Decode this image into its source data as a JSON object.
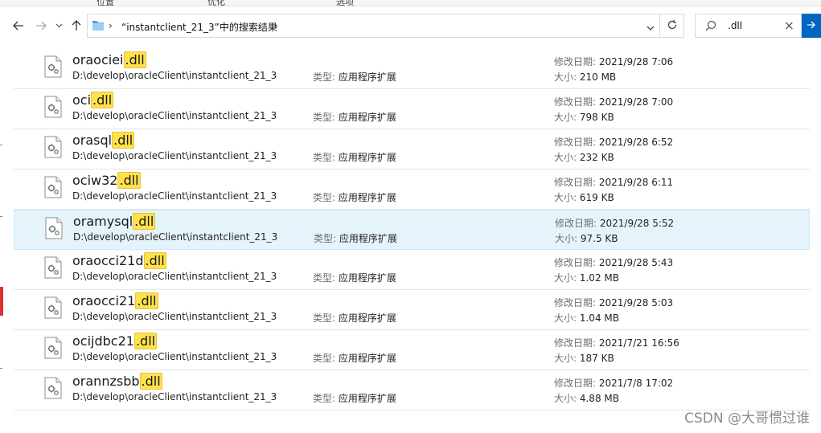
{
  "ribbon": {
    "tabs": [
      "位置",
      "优化",
      "选项"
    ]
  },
  "nav": {
    "back_icon": "arrow-left-icon",
    "forward_icon": "arrow-right-icon",
    "recent_icon": "chevron-down-icon",
    "up_icon": "arrow-up-icon"
  },
  "address": {
    "chevron_before": "›",
    "path": "“instantclient_21_3”中的搜索结果",
    "chevron_after": "›"
  },
  "search": {
    "value": ".dll",
    "clear": "×"
  },
  "labels": {
    "type": "类型: ",
    "modified": "修改日期: ",
    "size": "大小: "
  },
  "results": [
    {
      "name": ".dll",
      "stem": "oraociei",
      "path": "D:\\develop\\oracleClient\\instantclient_21_3",
      "type": "应用程序扩展",
      "modified": "2021/9/28 7:06",
      "size": "210 MB"
    },
    {
      "name": ".dll",
      "stem": "oci",
      "path": "D:\\develop\\oracleClient\\instantclient_21_3",
      "type": "应用程序扩展",
      "modified": "2021/9/28 7:00",
      "size": "798 KB"
    },
    {
      "name": ".dll",
      "stem": "orasql",
      "path": "D:\\develop\\oracleClient\\instantclient_21_3",
      "type": "应用程序扩展",
      "modified": "2021/9/28 6:52",
      "size": "232 KB"
    },
    {
      "name": ".dll",
      "stem": "ociw32",
      "path": "D:\\develop\\oracleClient\\instantclient_21_3",
      "type": "应用程序扩展",
      "modified": "2021/9/28 6:11",
      "size": "619 KB"
    },
    {
      "name": ".dll",
      "stem": "oramysql",
      "path": "D:\\develop\\oracleClient\\instantclient_21_3",
      "type": "应用程序扩展",
      "modified": "2021/9/28 5:52",
      "size": "97.5 KB"
    },
    {
      "name": ".dll",
      "stem": "oraocci21d",
      "path": "D:\\develop\\oracleClient\\instantclient_21_3",
      "type": "应用程序扩展",
      "modified": "2021/9/28 5:43",
      "size": "1.02 MB"
    },
    {
      "name": ".dll",
      "stem": "oraocci21",
      "path": "D:\\develop\\oracleClient\\instantclient_21_3",
      "type": "应用程序扩展",
      "modified": "2021/9/28 5:03",
      "size": "1.04 MB"
    },
    {
      "name": ".dll",
      "stem": "ocijdbc21",
      "path": "D:\\develop\\oracleClient\\instantclient_21_3",
      "type": "应用程序扩展",
      "modified": "2021/7/21 16:56",
      "size": "187 KB"
    },
    {
      "name": ".dll",
      "stem": "orannzsbb",
      "path": "D:\\develop\\oracleClient\\instantclient_21_3",
      "type": "应用程序扩展",
      "modified": "2021/7/8 17:02",
      "size": "4.88 MB"
    }
  ],
  "selected_index": 4,
  "watermark": "CSDN @大哥惯过谁",
  "colors": {
    "highlight": "#ffe14b",
    "selection": "#e5f3fb",
    "accent": "#0067c0"
  }
}
